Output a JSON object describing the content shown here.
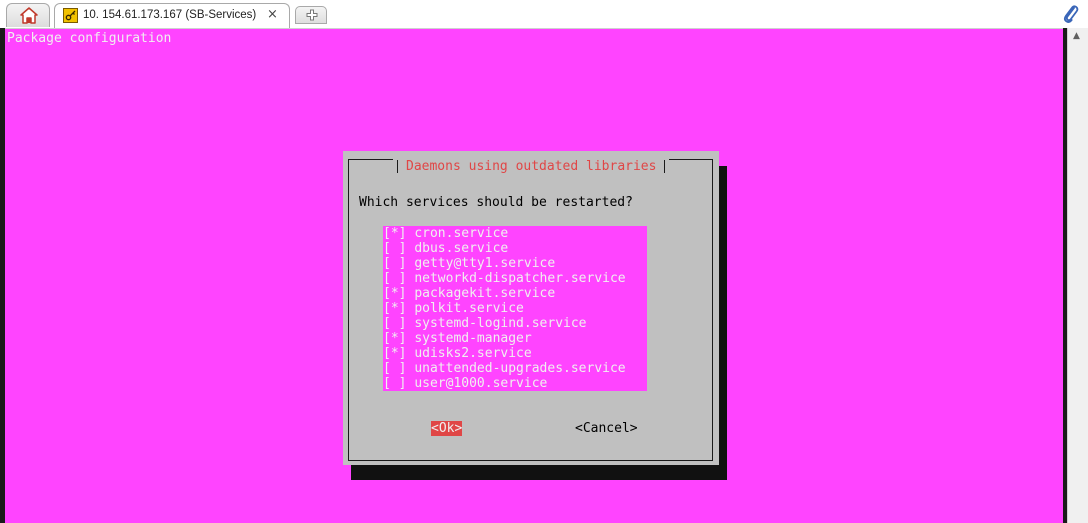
{
  "browser": {
    "tab_title": "10. 154.61.173.167 (SB-Services)",
    "tab_close": "×",
    "icons": {
      "home": "home-icon",
      "tab": "key-icon",
      "new_tab": "plus-icon",
      "attachment": "paperclip-icon"
    }
  },
  "terminal": {
    "header": "Package configuration",
    "dialog": {
      "title": "Daemons using outdated libraries",
      "question": "Which services should be restarted?",
      "services": [
        {
          "mark": "[*]",
          "name": "cron.service"
        },
        {
          "mark": "[ ]",
          "name": "dbus.service"
        },
        {
          "mark": "[ ]",
          "name": "getty@tty1.service"
        },
        {
          "mark": "[ ]",
          "name": "networkd-dispatcher.service"
        },
        {
          "mark": "[*]",
          "name": "packagekit.service"
        },
        {
          "mark": "[*]",
          "name": "polkit.service"
        },
        {
          "mark": "[ ]",
          "name": "systemd-logind.service"
        },
        {
          "mark": "[*]",
          "name": "systemd-manager"
        },
        {
          "mark": "[*]",
          "name": "udisks2.service"
        },
        {
          "mark": "[ ]",
          "name": "unattended-upgrades.service"
        },
        {
          "mark": "[ ]",
          "name": "user@1000.service"
        }
      ],
      "ok_label": "<Ok>",
      "cancel_label": "<Cancel>"
    }
  },
  "colors": {
    "terminal_bg": "#ff44ff",
    "dialog_bg": "#c0c0c0",
    "title_red": "#e04646",
    "text_light": "#f0f0f0"
  }
}
